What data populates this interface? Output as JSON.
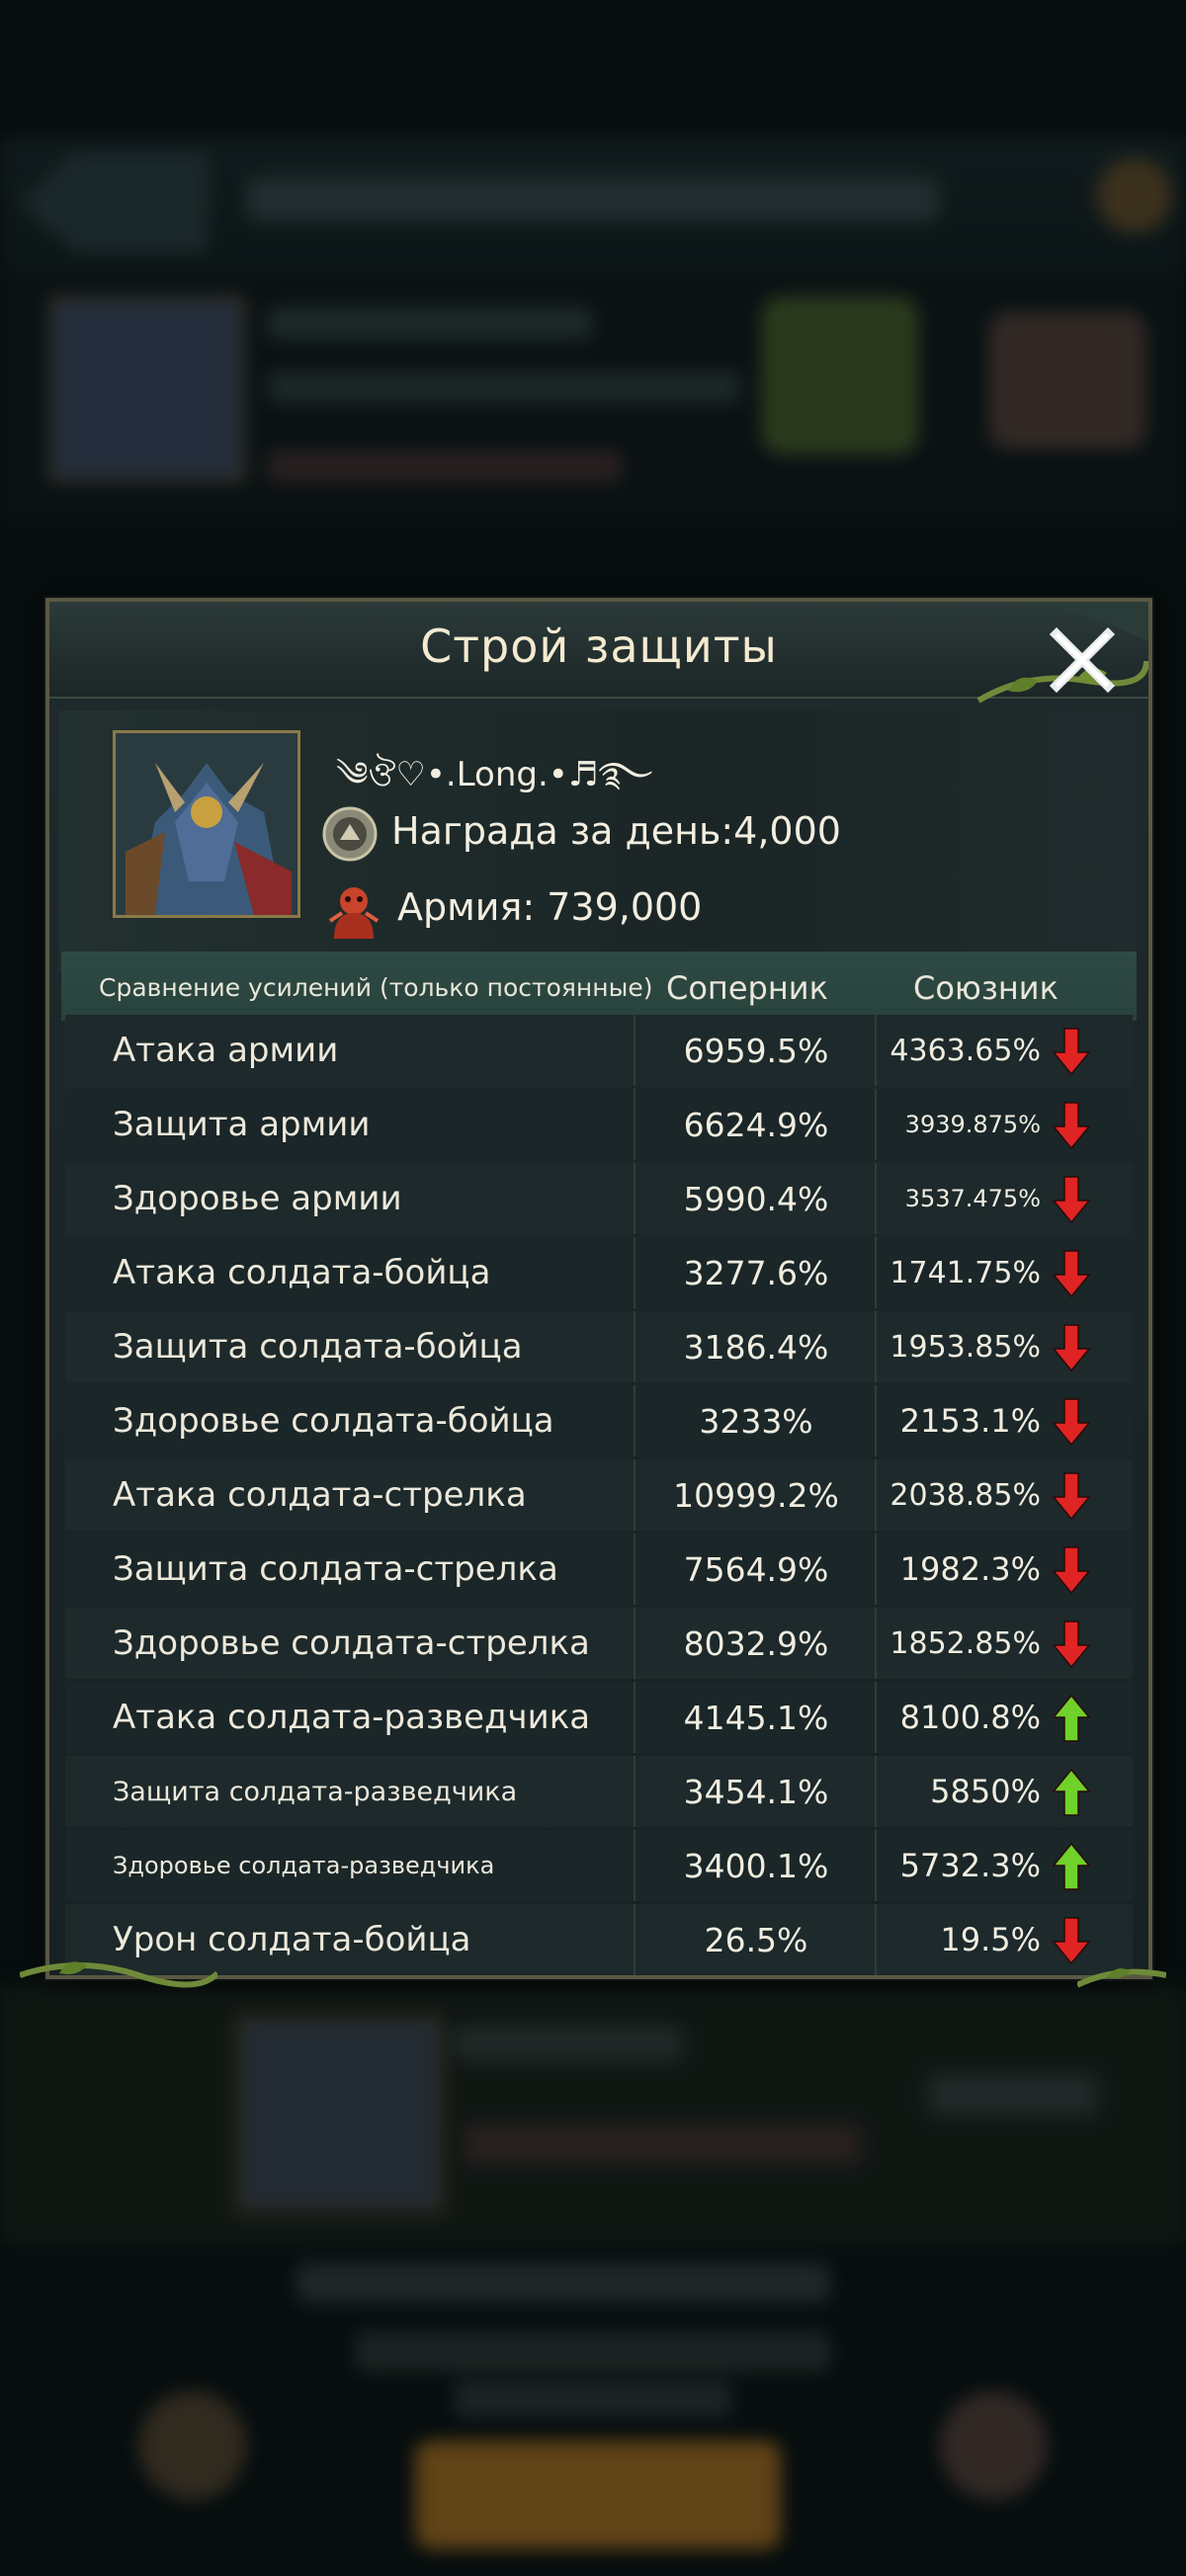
{
  "dialog": {
    "title": "Строй защиты"
  },
  "player": {
    "name": "༄ঔ♡•.Long.•♬࿐",
    "reward": "Награда за день:4,000",
    "army": "Армия: 739,000"
  },
  "table": {
    "header_label": "Сравнение усилений (только постоянные)",
    "header_enemy": "Соперник",
    "header_ally": "Союзник",
    "rows": [
      {
        "name": "Атака армии",
        "enemy": "6959.5%",
        "ally": "4363.65%",
        "trend": "down"
      },
      {
        "name": "Защита армии",
        "enemy": "6624.9%",
        "ally": "3939.875%",
        "trend": "down"
      },
      {
        "name": "Здоровье армии",
        "enemy": "5990.4%",
        "ally": "3537.475%",
        "trend": "down"
      },
      {
        "name": "Атака солдата-бойца",
        "enemy": "3277.6%",
        "ally": "1741.75%",
        "trend": "down"
      },
      {
        "name": "Защита солдата-бойца",
        "enemy": "3186.4%",
        "ally": "1953.85%",
        "trend": "down"
      },
      {
        "name": "Здоровье солдата-бойца",
        "enemy": "3233%",
        "ally": "2153.1%",
        "trend": "down"
      },
      {
        "name": "Атака солдата-стрелка",
        "enemy": "10999.2%",
        "ally": "2038.85%",
        "trend": "down"
      },
      {
        "name": "Защита солдата-стрелка",
        "enemy": "7564.9%",
        "ally": "1982.3%",
        "trend": "down"
      },
      {
        "name": "Здоровье солдата-стрелка",
        "enemy": "8032.9%",
        "ally": "1852.85%",
        "trend": "down"
      },
      {
        "name": "Атака солдата-разведчика",
        "enemy": "4145.1%",
        "ally": "8100.8%",
        "trend": "up"
      },
      {
        "name": "Защита солдата-разведчика",
        "enemy": "3454.1%",
        "ally": "5850%",
        "trend": "up"
      },
      {
        "name": "Здоровье солдата-разведчика",
        "enemy": "3400.1%",
        "ally": "5732.3%",
        "trend": "up"
      },
      {
        "name": "Урон солдата-бойца",
        "enemy": "26.5%",
        "ally": "19.5%",
        "trend": "down"
      }
    ]
  },
  "colors": {
    "arrow_down": "#e02424",
    "arrow_up": "#6fd12a",
    "frame": "#5a5842"
  }
}
